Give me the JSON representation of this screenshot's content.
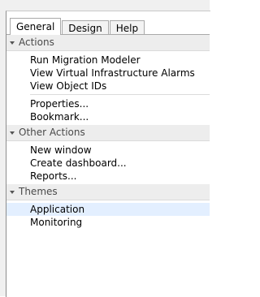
{
  "tabs": [
    {
      "label": "General",
      "active": true
    },
    {
      "label": "Design",
      "active": false
    },
    {
      "label": "Help",
      "active": false
    }
  ],
  "sections": [
    {
      "header": "Actions",
      "groups": [
        [
          "Run Migration Modeler",
          "View Virtual Infrastructure Alarms",
          "View Object IDs"
        ],
        [
          "Properties...",
          "Bookmark..."
        ]
      ]
    },
    {
      "header": "Other Actions",
      "groups": [
        [
          "New window",
          "Create dashboard...",
          "Reports..."
        ]
      ]
    },
    {
      "header": "Themes",
      "groups": [
        [
          "Application",
          "Monitoring"
        ]
      ],
      "selected": "Application"
    }
  ],
  "icons": {
    "expanded": "triangle-down-icon"
  },
  "colors": {
    "section_bg": "#ededed",
    "selected_bg": "#e3efff"
  }
}
